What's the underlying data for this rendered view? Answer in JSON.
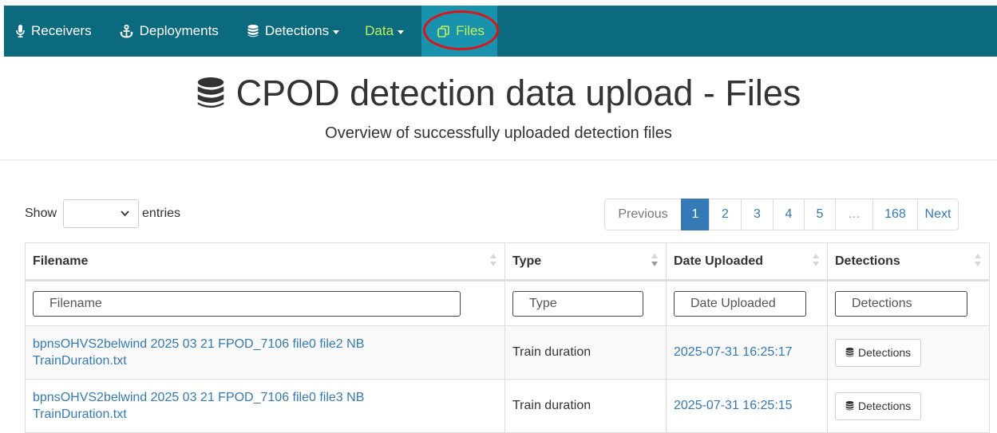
{
  "nav": {
    "receivers": "Receivers",
    "deployments": "Deployments",
    "detections": "Detections",
    "data": "Data",
    "files": "Files"
  },
  "header": {
    "title": "CPOD detection data upload - Files",
    "subtitle": "Overview of successfully uploaded detection files"
  },
  "length": {
    "show": "Show",
    "entries": "entries",
    "selected": ""
  },
  "pagination": {
    "previous": "Previous",
    "pages": [
      "1",
      "2",
      "3",
      "4",
      "5"
    ],
    "ellipsis": "…",
    "last": "168",
    "next": "Next",
    "current": "1"
  },
  "table": {
    "headers": [
      "Filename",
      "Type",
      "Date Uploaded",
      "Detections"
    ],
    "filters": [
      "Filename",
      "Type",
      "Date Uploaded",
      "Detections"
    ],
    "rows": [
      {
        "filename_line1": "bpnsOHVS2belwind 2025 03 21 FPOD_7106 file0 file2 NB",
        "filename_line2": "TrainDuration.txt",
        "type": "Train duration",
        "date": "2025-07-31 16:25:17",
        "button": "Detections"
      },
      {
        "filename_line1": "bpnsOHVS2belwind 2025 03 21 FPOD_7106 file0 file3 NB",
        "filename_line2": "TrainDuration.txt",
        "type": "Train duration",
        "date": "2025-07-31 16:25:15",
        "button": "Detections"
      }
    ]
  },
  "colors": {
    "navbar": "#0b6a7d",
    "nav_active": "#1992ad",
    "nav_highlight_text": "#bff05a",
    "link": "#337ab7",
    "annotation_circle": "#d9141b"
  },
  "icons": {
    "receivers": "microphone-icon",
    "deployments": "anchor-icon",
    "detections": "database-icon",
    "files": "copy-icon"
  }
}
